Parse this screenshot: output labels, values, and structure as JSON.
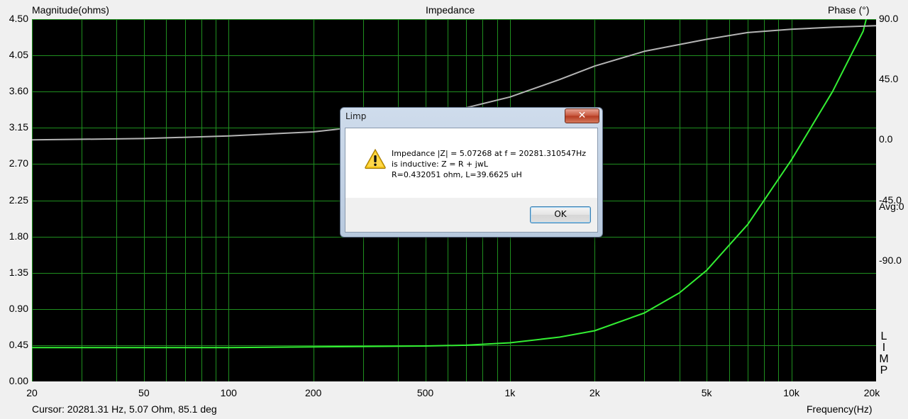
{
  "header": {
    "left_axis_title": "Magnitude(ohms)",
    "chart_title": "Impedance",
    "right_axis_title": "Phase (°)"
  },
  "right_labels": {
    "avg": "Avg:0",
    "brand_letters": [
      "L",
      "I",
      "M",
      "P"
    ]
  },
  "status": {
    "cursor": "Cursor: 20281.31 Hz, 5.07 Ohm, 85.1 deg",
    "x_axis_title": "Frequency(Hz)"
  },
  "colors": {
    "plot_bg": "#000000",
    "grid": "#1f8f1f",
    "magnitude_trace": "#33ee33",
    "phase_trace": "#b4b4b4"
  },
  "chart_data": {
    "type": "line",
    "x_scale": "log",
    "xlim": [
      20,
      20000
    ],
    "ylim": [
      0,
      4.5
    ],
    "y2lim": [
      -180,
      90
    ],
    "grid": true,
    "x_ticks": [
      20,
      50,
      100,
      200,
      500,
      1000,
      2000,
      5000,
      10000,
      20000
    ],
    "x_tick_labels": [
      "20",
      "50",
      "100",
      "200",
      "500",
      "1k",
      "2k",
      "5k",
      "10k",
      "20k"
    ],
    "y_ticks": [
      4.5,
      4.05,
      3.6,
      3.15,
      2.7,
      2.25,
      1.8,
      1.35,
      0.9,
      0.45,
      0.0
    ],
    "y_tick_labels": [
      "4.50",
      "4.05",
      "3.60",
      "3.15",
      "2.70",
      "2.25",
      "1.80",
      "1.35",
      "0.90",
      "0.45",
      "0.00"
    ],
    "y2_ticks": [
      90,
      45,
      0,
      -45,
      -90
    ],
    "y2_tick_labels": [
      "90.0",
      "45.0",
      "0.0",
      "-45.0",
      "-90.0"
    ],
    "series": [
      {
        "axis": "left",
        "x": [
          20,
          50,
          100,
          200,
          500,
          700,
          1000,
          1500,
          2000,
          3000,
          4000,
          5000,
          7000,
          10000,
          14000,
          18000,
          20281
        ],
        "values": [
          0.42,
          0.42,
          0.42,
          0.43,
          0.44,
          0.45,
          0.48,
          0.55,
          0.63,
          0.85,
          1.1,
          1.38,
          1.95,
          2.75,
          3.6,
          4.35,
          5.07
        ]
      },
      {
        "axis": "right",
        "x": [
          20,
          50,
          100,
          200,
          300,
          500,
          700,
          1000,
          1500,
          2000,
          3000,
          5000,
          7000,
          10000,
          14000,
          20000
        ],
        "values": [
          0,
          1,
          3,
          6,
          10,
          16,
          24,
          32,
          45,
          55,
          66,
          75,
          80,
          82.5,
          84,
          85.1
        ]
      }
    ]
  },
  "dialog": {
    "title": "Limp",
    "close_label": "✕",
    "message_line1": "Impedance  |Z| = 5.07268 at f = 20281.310547Hz",
    "message_line2": "is inductive: Z = R + jwL",
    "message_line3": "R=0.432051 ohm, L=39.6625 uH",
    "ok_label": "OK"
  }
}
